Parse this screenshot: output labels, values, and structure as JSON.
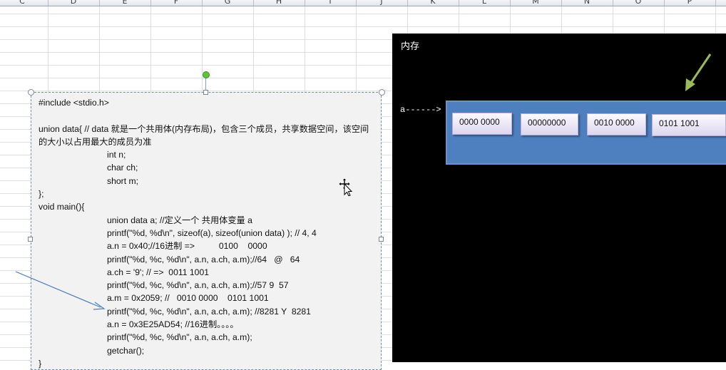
{
  "spreadsheet": {
    "columns": [
      "C",
      "D",
      "E",
      "F",
      "G",
      "H",
      "I",
      "J",
      "K",
      "L",
      "M",
      "N",
      "O",
      "P"
    ]
  },
  "code_box": {
    "lines": [
      "#include <stdio.h>",
      "",
      "union data{ // data 就是一个共用体(内存布局)，包含三个成员，共享数据空间，该空间的大小以占用最大的成员为准",
      "int n;",
      "char ch;",
      "short m;",
      "};",
      "void main(){",
      "union data a; //定义一个 共用体变量 a",
      "printf(\"%d, %d\\n\", sizeof(a), sizeof(union data) ); // 4, 4",
      "a.n = 0x40;//16进制 =>          0100    0000",
      "printf(\"%d, %c, %d\\n\", a.n, a.ch, a.m);//64   @   64",
      "a.ch = '9'; // =>  0011 1001",
      "printf(\"%d, %c, %d\\n\", a.n, a.ch, a.m);//57 9  57",
      "a.m = 0x2059; //   0010 0000    0101 1001",
      "printf(\"%d, %c, %d\\n\", a.n, a.ch, a.m); //8281 Y  8281",
      "a.n = 0x3E25AD54; //16进制。。。。",
      "printf(\"%d, %c, %d\\n\", a.n, a.ch, a.m);",
      "getchar();",
      "}"
    ]
  },
  "memory_panel": {
    "title": "内存",
    "pointer_label": "a------>",
    "cells": [
      "0000 0000",
      "00000000",
      "0010 0000",
      "0101 1001"
    ]
  },
  "colors": {
    "memory_background": "#000000",
    "memory_block": "#4e7fbf",
    "green_arrow": "#9bbb59",
    "blue_arrow": "#4a7ebb"
  }
}
